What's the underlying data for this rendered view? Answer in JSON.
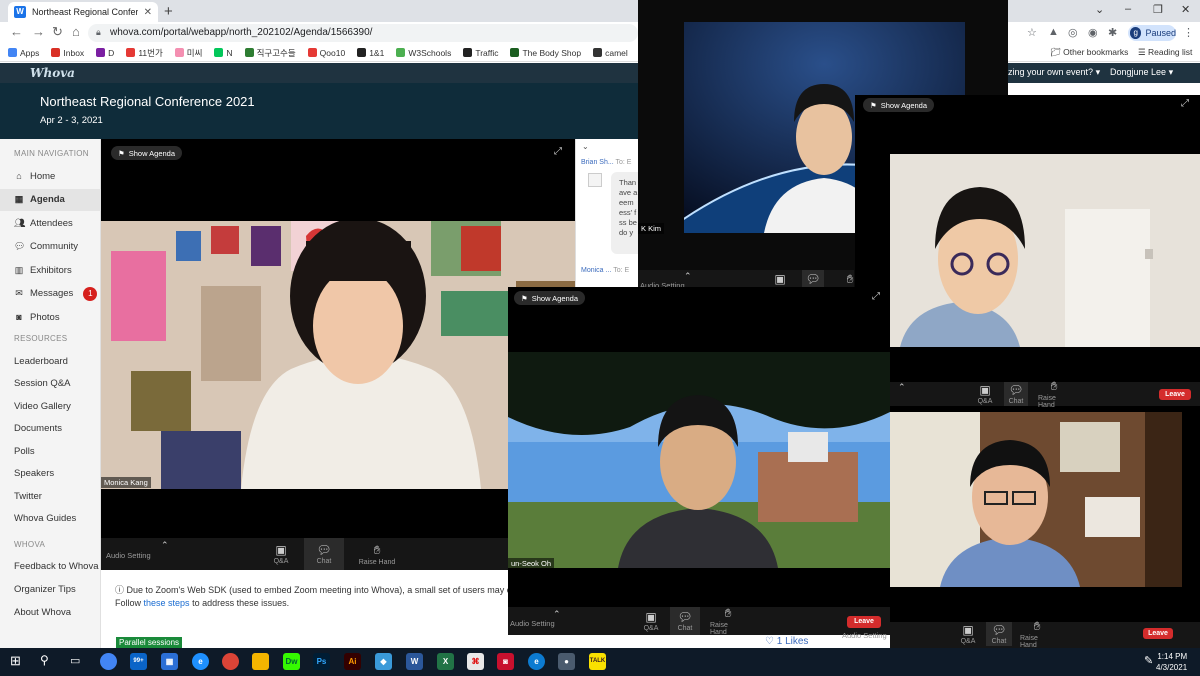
{
  "browser": {
    "tab_title": "Northeast Regional Confere",
    "url": "whova.com/portal/webapp/north_202102/Agenda/1566390/",
    "profile_label": "Paused",
    "profile_initial": "g",
    "bookmarks": [
      {
        "label": "Apps",
        "color": "#4285f4"
      },
      {
        "label": "Inbox",
        "color": "#d93025"
      },
      {
        "label": "D",
        "color": "#7b1fa2"
      },
      {
        "label": "11번가",
        "color": "#e53935"
      },
      {
        "label": "미씨",
        "color": "#f48fb1"
      },
      {
        "label": "N",
        "color": "#03c75a"
      },
      {
        "label": "직구고수들",
        "color": "#2e7d32"
      },
      {
        "label": "Qoo10",
        "color": "#e53935"
      },
      {
        "label": "1&1",
        "color": "#222222"
      },
      {
        "label": "W3Schools",
        "color": "#4caf50"
      },
      {
        "label": "Traffic",
        "color": "#222222"
      },
      {
        "label": "The Body Shop",
        "color": "#1b5e20"
      },
      {
        "label": "camel",
        "color": "#333333"
      },
      {
        "label": "관세청",
        "color": "#1a237e"
      }
    ],
    "other_bookmarks": "Other bookmarks",
    "reading_list": "Reading list"
  },
  "whova": {
    "logo": "Whova",
    "top_right_text": "zing your own event?",
    "user": "Dongjune Lee",
    "conference_title": "Northeast Regional Conference 2021",
    "dates": "Apr 2 - 3, 2021"
  },
  "sidebar": {
    "main_nav_label": "MAIN NAVIGATION",
    "main_items": [
      {
        "label": "Home",
        "icon": "home-icon"
      },
      {
        "label": "Agenda",
        "icon": "agenda-icon"
      },
      {
        "label": "Attendees",
        "icon": "attendees-icon"
      },
      {
        "label": "Community",
        "icon": "community-icon"
      },
      {
        "label": "Exhibitors",
        "icon": "exhibitors-icon"
      },
      {
        "label": "Messages",
        "icon": "envelope-icon",
        "badge": "1"
      },
      {
        "label": "Photos",
        "icon": "camera-icon"
      }
    ],
    "resources_label": "RESOURCES",
    "resource_items": [
      "Leaderboard",
      "Session Q&A",
      "Video Gallery",
      "Documents",
      "Polls",
      "Speakers",
      "Twitter",
      "Whova Guides"
    ],
    "whova_label": "WHOVA",
    "whova_items": [
      "Feedback to Whova",
      "Organizer Tips",
      "About Whova"
    ]
  },
  "zoom": {
    "show_agenda": "Show Agenda",
    "audio_setting": "Audio Setting",
    "qa": "Q&A",
    "chat": "Chat",
    "raise_hand": "Raise Hand",
    "leave": "Leave",
    "participants": {
      "main": "Monica Kang",
      "top_center": "K Kim",
      "bottom_center": "un-Seok Oh"
    }
  },
  "chat": {
    "sender1": "Brian Sh...",
    "to1": "To: E",
    "message": "Than ave a eem ess' f ss be do y",
    "sender2": "Monica ...",
    "to2": "To: E"
  },
  "content": {
    "notice_text": "Due to Zoom's Web SDK (used to embed Zoom meeting into Whova), a small set of users may exp",
    "notice_follow": "Follow",
    "notice_link": "these steps",
    "notice_end": "to address these issues.",
    "parallel_label": "Parallel sessions",
    "likes": "1 Likes"
  },
  "taskbar": {
    "time": "1:14 PM",
    "date": "4/3/2021",
    "mail_count": "99+"
  }
}
